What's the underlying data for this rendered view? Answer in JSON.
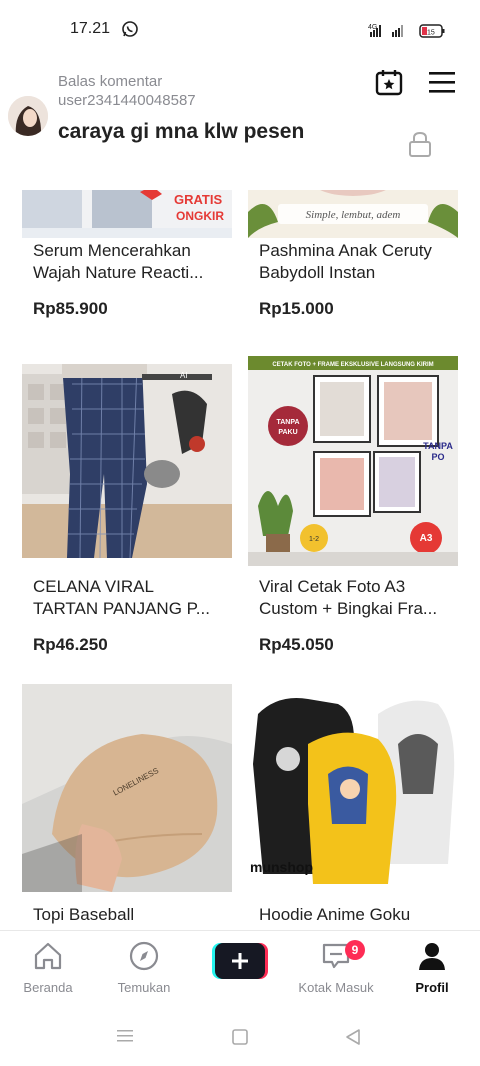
{
  "status": {
    "time": "17.21",
    "battery": "15"
  },
  "header": {
    "reply_label": "Balas komentar",
    "reply_user": "user2341440048587",
    "reply_text": "caraya gi mna klw pesen"
  },
  "products": [
    {
      "title": "Serum Mencerahkan Wajah Nature Reacti...",
      "line1": "Serum Mencerahkan",
      "line2": "Wajah Nature Reacti...",
      "price": "Rp85.900",
      "badge": "GRATIS ONGKIR"
    },
    {
      "title": "Pashmina Anak Ceruty Babydoll Instan",
      "line1": "Pashmina Anak Ceruty",
      "line2": "Babydoll Instan",
      "price": "Rp15.000",
      "banner": "Simple, lembut, adem"
    },
    {
      "title": "CELANA VIRAL TARTAN PANJANG P...",
      "line1": "CELANA VIRAL",
      "line2": "TARTAN PANJANG P...",
      "price": "Rp46.250"
    },
    {
      "title": "Viral Cetak Foto A3 Custom + Bingkai Fra...",
      "line1": "Viral Cetak Foto A3",
      "line2": "Custom + Bingkai Fra...",
      "price": "Rp45.050",
      "tag1": "TANPA PAKU",
      "tag2": "TANPA PO",
      "tag3": "A3",
      "top_banner": "CETAK FOTO + FRAME EKSKLUSIVE LANGSUNG KIRIM"
    },
    {
      "title": "Topi Baseball",
      "line1": "Topi Baseball",
      "price": ""
    },
    {
      "title": "Hoodie Anime Goku",
      "line1": "Hoodie Anime Goku",
      "price": "",
      "watermark": "munshop"
    }
  ],
  "nav": {
    "items": [
      {
        "label": "Beranda",
        "icon": "home-icon"
      },
      {
        "label": "Temukan",
        "icon": "compass-icon"
      },
      {
        "label": "",
        "icon": "plus-icon"
      },
      {
        "label": "Kotak Masuk",
        "icon": "inbox-icon"
      },
      {
        "label": "Profil",
        "icon": "profile-icon"
      }
    ],
    "inbox_badge": "9"
  },
  "colors": {
    "accent": "#fe2c55",
    "cyan": "#25f4ee",
    "text": "#161823",
    "muted": "#8a8b91"
  }
}
